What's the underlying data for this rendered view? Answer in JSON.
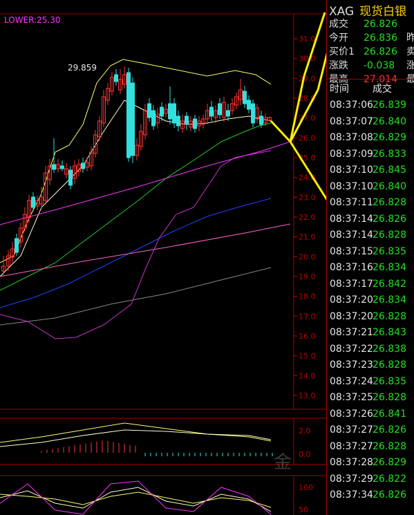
{
  "indicator": {
    "lower_label": "LOWER:25.30",
    "peak_label": "29.859"
  },
  "price_axis": {
    "ticks": [
      "31.0",
      "30.0",
      "29.0",
      "28.0",
      "27.0",
      "26.0",
      "25.0",
      "24.0",
      "23.0",
      "22.0",
      "21.0",
      "20.0",
      "19.0",
      "18.0",
      "17.0",
      "16.0",
      "15.0",
      "14.0",
      "13.0"
    ],
    "macd_ticks": [
      "2.0",
      "0.0"
    ],
    "kdj_ticks": [
      "100",
      "50"
    ]
  },
  "quote": {
    "symbol": "XAG",
    "name": "现货白银",
    "rows": [
      {
        "label": "成交",
        "value": "26.826",
        "right": ""
      },
      {
        "label": "今开",
        "value": "26.836",
        "right": "昨"
      },
      {
        "label": "买价1",
        "value": "26.826",
        "right": "卖"
      },
      {
        "label": "涨跌",
        "value": "-0.038",
        "right": "涨"
      },
      {
        "label": "最高",
        "value": "27.014",
        "right": "最"
      }
    ]
  },
  "ticks_table": {
    "headers": [
      "时间",
      "成交"
    ],
    "rows": [
      [
        "08:37:06",
        "26.839"
      ],
      [
        "08:37:07",
        "26.840"
      ],
      [
        "08:37:08",
        "26.829"
      ],
      [
        "08:37:09",
        "26.833"
      ],
      [
        "08:37:10",
        "26.845"
      ],
      [
        "08:37:10",
        "26.840"
      ],
      [
        "08:37:11",
        "26.828"
      ],
      [
        "08:37:14",
        "26.826"
      ],
      [
        "08:37:14",
        "26.828"
      ],
      [
        "08:37:15",
        "26.835"
      ],
      [
        "08:37:16",
        "26.834"
      ],
      [
        "08:37:17",
        "26.842"
      ],
      [
        "08:37:20",
        "26.834"
      ],
      [
        "08:37:20",
        "26.828"
      ],
      [
        "08:37:21",
        "26.843"
      ],
      [
        "08:37:22",
        "26.838"
      ],
      [
        "08:37:23",
        "26.828"
      ],
      [
        "08:37:24",
        "26.835"
      ],
      [
        "08:37:25",
        "26.828"
      ],
      [
        "08:37:26",
        "26.841"
      ],
      [
        "08:37:27",
        "26.826"
      ],
      [
        "08:37:27",
        "26.828"
      ],
      [
        "08:37:28",
        "26.829"
      ],
      [
        "08:37:29",
        "26.822"
      ],
      [
        "08:37:34",
        "26.826"
      ]
    ]
  },
  "watermark": "金",
  "colors": {
    "axis_red": "#c00000",
    "yellow": "#ffd000",
    "green": "#22e022",
    "cyan": "#33e0e0",
    "magenta": "#ff33ff",
    "blue": "#2244ff"
  }
}
